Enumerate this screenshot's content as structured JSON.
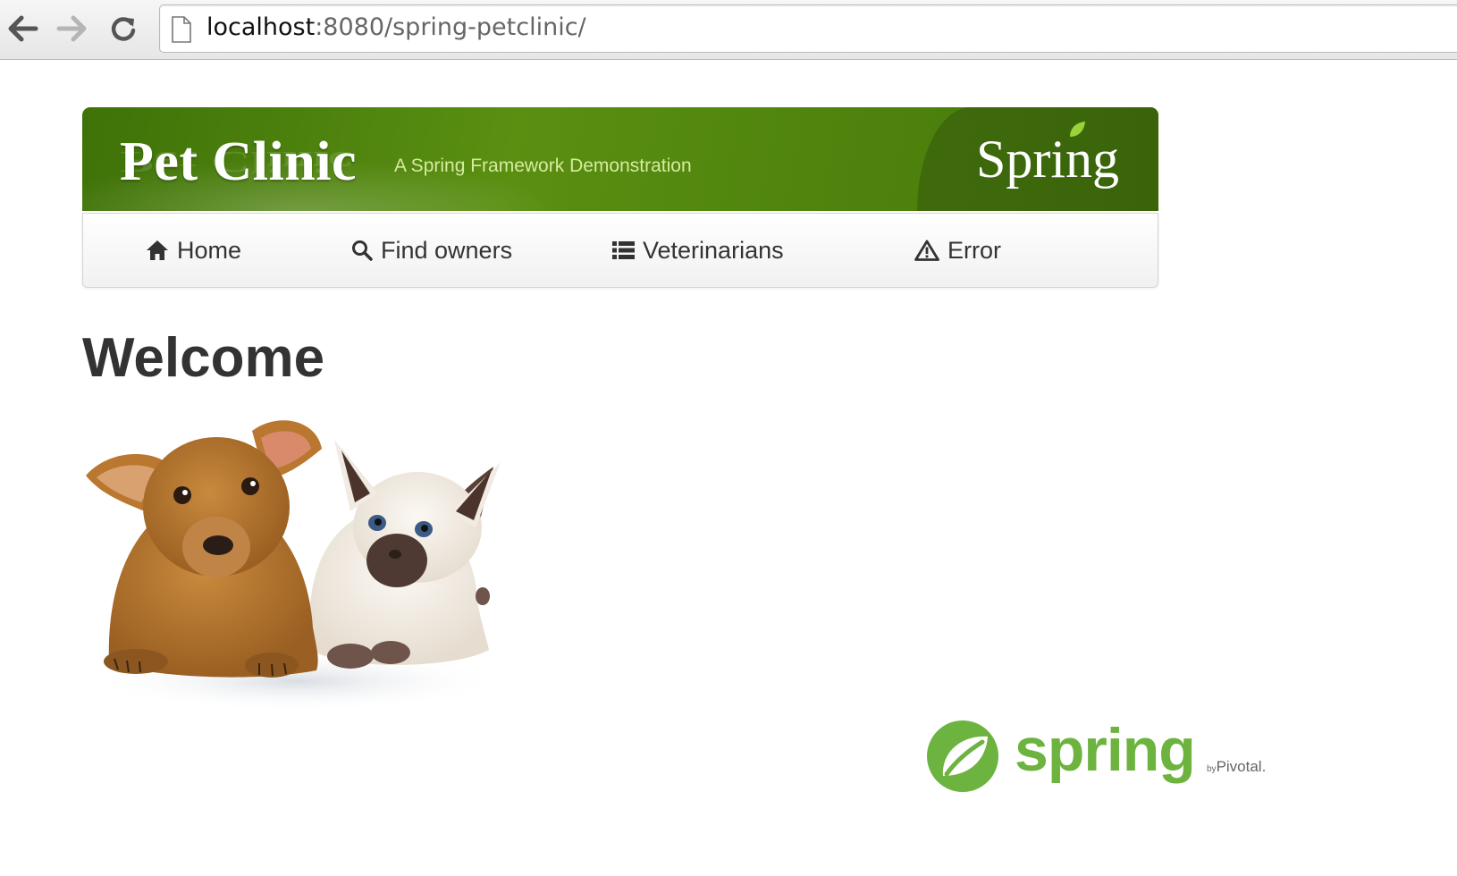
{
  "browser": {
    "url_host": "localhost",
    "url_rest": ":8080/spring-petclinic/",
    "back_icon": "arrow-left-icon",
    "forward_icon": "arrow-right-icon",
    "reload_icon": "reload-icon"
  },
  "banner": {
    "title": "Pet Clinic",
    "subtitle": "A Spring Framework Demonstration",
    "brand": "Spring"
  },
  "nav": {
    "items": [
      {
        "label": "Home",
        "icon": "home-icon"
      },
      {
        "label": "Find owners",
        "icon": "search-icon"
      },
      {
        "label": "Veterinarians",
        "icon": "list-icon"
      },
      {
        "label": "Error",
        "icon": "warning-icon"
      }
    ]
  },
  "main": {
    "heading": "Welcome",
    "image": "pets-image"
  },
  "footer": {
    "logo_word": "spring",
    "by": "by",
    "pivotal": "Pivotal."
  },
  "colors": {
    "banner_green": "#5a8f12",
    "spring_green": "#6db33f",
    "text": "#333333"
  }
}
